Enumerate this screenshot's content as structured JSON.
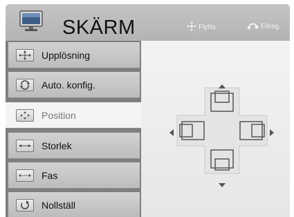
{
  "header": {
    "title": "SKÄRM",
    "move_label": "Flytta",
    "move_icon": "move-arrows-icon",
    "prev_label": "Föreg.",
    "prev_icon": "back-arrow-icon"
  },
  "menu": {
    "items": [
      {
        "label": "Upplösning",
        "icon": "resolution-icon"
      },
      {
        "label": "Auto. konfig.",
        "icon": "auto-config-icon"
      },
      {
        "label": "Position",
        "icon": "position-icon",
        "selected": true
      },
      {
        "label": "Storlek",
        "icon": "size-icon"
      },
      {
        "label": "Fas",
        "icon": "phase-icon"
      },
      {
        "label": "Nollställ",
        "icon": "reset-icon"
      }
    ]
  },
  "colors": {
    "menu_bg": "#7f7f7f",
    "selected_bg": "#f4f4f4",
    "header_bg": "#bcbcbc"
  }
}
